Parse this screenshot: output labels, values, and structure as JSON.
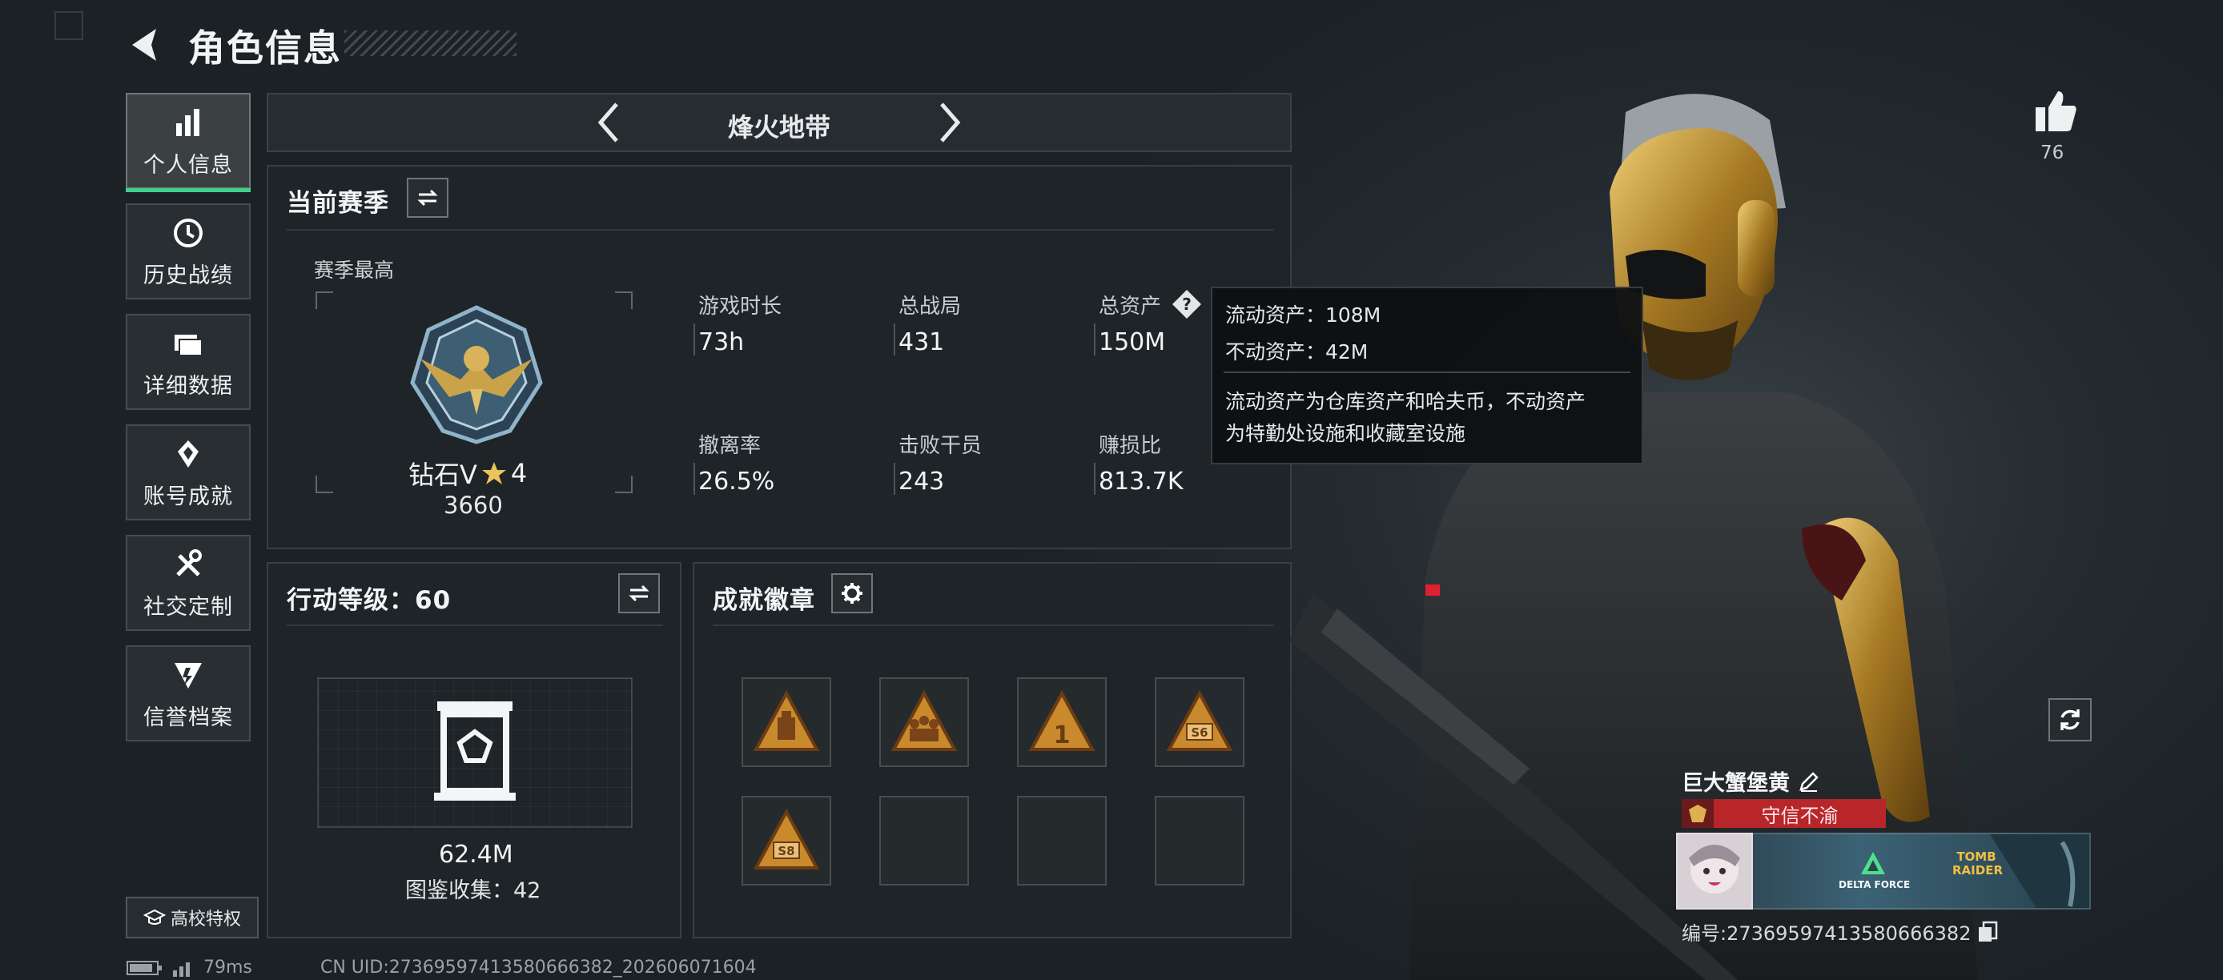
{
  "header": {
    "title": "角色信息"
  },
  "sidebar": {
    "items": [
      {
        "label": "个人信息",
        "icon": "bar-chart-icon",
        "active": true
      },
      {
        "label": "历史战绩",
        "icon": "clock-icon"
      },
      {
        "label": "详细数据",
        "icon": "folder-icon"
      },
      {
        "label": "账号成就",
        "icon": "achievement-icon"
      },
      {
        "label": "社交定制",
        "icon": "tools-icon"
      },
      {
        "label": "信誉档案",
        "icon": "credit-badge-icon"
      }
    ],
    "campus_label": "高校特权"
  },
  "mode": {
    "title": "烽火地带"
  },
  "season": {
    "section_title": "当前赛季",
    "best_label": "赛季最高",
    "rank_name": "钻石V",
    "rank_stars": "4",
    "rank_score": "3660",
    "stats": [
      {
        "label": "游戏时长",
        "value": "73h"
      },
      {
        "label": "总战局",
        "value": "431"
      },
      {
        "label": "总资产",
        "value": "150M"
      },
      {
        "label": "撤离率",
        "value": "26.5%"
      },
      {
        "label": "击败干员",
        "value": "243"
      },
      {
        "label": "赚损比",
        "value": "813.7K"
      }
    ]
  },
  "tooltip": {
    "line1": "流动资产：108M",
    "line2": "不动资产：42M",
    "line3": "流动资产为仓库资产和哈夫币，不动资产",
    "line4": "为特勤处设施和收藏室设施"
  },
  "action_level": {
    "title": "行动等级：60",
    "value": "62.4M",
    "collection": "图鉴收集：42"
  },
  "achievements": {
    "title": "成就徽章",
    "badges": [
      {
        "icon": "safe-badge-icon",
        "filled": true
      },
      {
        "icon": "squad-badge-icon",
        "filled": true
      },
      {
        "icon": "number-one-badge-icon",
        "filled": true,
        "text": "1"
      },
      {
        "icon": "season-s6-badge-icon",
        "filled": true,
        "text": "S6"
      },
      {
        "icon": "season-s8-badge-icon",
        "filled": true,
        "text": "S8"
      },
      {
        "filled": false
      },
      {
        "filled": false
      },
      {
        "filled": false
      }
    ]
  },
  "profile": {
    "likes": "76",
    "player_name": "巨大蟹堡黄",
    "player_title": "守信不渝",
    "player_id": "编号:2736959741358066638​2",
    "banner_text": "DELTA FORCE",
    "banner_game": "TOMB RAIDER"
  },
  "status": {
    "ping": "79ms",
    "uid": "CN UID:2736959741358066638​2_202606071604"
  },
  "colors": {
    "accent_green": "#3fd18a",
    "title_red": "#b8262a",
    "gold": "#c9a24a"
  }
}
